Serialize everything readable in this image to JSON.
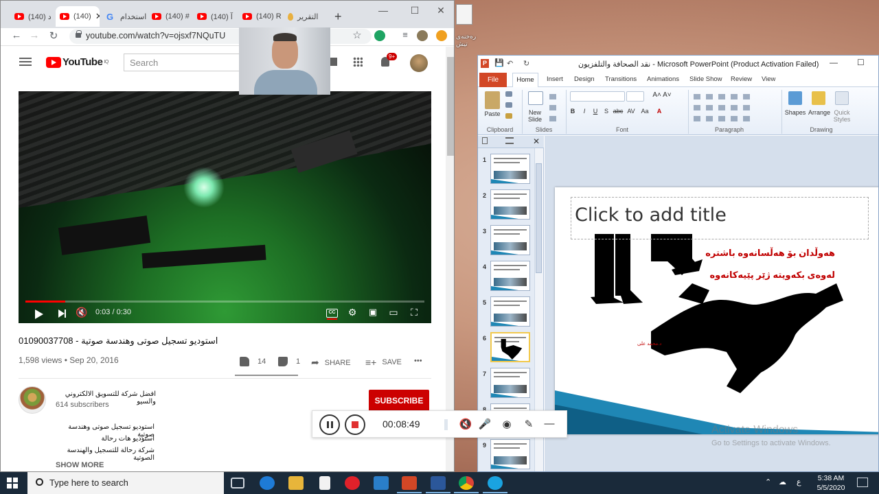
{
  "desktop": {
    "icon_label": "رەخنەی تیش"
  },
  "chrome": {
    "tabs": [
      {
        "label": "(140) د"
      },
      {
        "label": "(140)"
      },
      {
        "label": "استخدام"
      },
      {
        "label": "(140) #"
      },
      {
        "label": "(140) آ"
      },
      {
        "label": "(140) R"
      },
      {
        "label": "التقرير"
      }
    ],
    "new_tab": "+",
    "url": "youtube.com/watch?v=ojsxf7NQuTU"
  },
  "youtube": {
    "logo": "YouTube",
    "logo_region": "IQ",
    "search_placeholder": "Search",
    "notifications": "9+",
    "player": {
      "time": "0:03 / 0:30",
      "cc": "CC",
      "progress": 0.1
    },
    "title": "استوديو تسجيل صوتى وهندسة صوتية - 01090037708",
    "views": "1,598 views • Sep 20, 2016",
    "likes": "14",
    "dislikes": "1",
    "share": "SHARE",
    "save": "SAVE",
    "more": "•••",
    "channel_name": "افضل شركة للتسويق الالكتروني والسيو",
    "subscribers": "614 subscribers",
    "subscribe": "SUBSCRIBE",
    "description": [
      "استوديو تسجيل صوتى وهندسة صوتية",
      "استوديو هات رحالة",
      "شركة رحالة للتسجيل والهندسة الصوتية"
    ],
    "show_more": "SHOW MORE"
  },
  "recorder": {
    "elapsed": "00:08:49"
  },
  "powerpoint": {
    "title": "نقد الصحافة والتلفزيون - Microsoft PowerPoint (Product Activation Failed)",
    "tabs": [
      "File",
      "Home",
      "Insert",
      "Design",
      "Transitions",
      "Animations",
      "Slide Show",
      "Review",
      "View"
    ],
    "groups": [
      "Clipboard",
      "Slides",
      "Font",
      "Paragraph",
      "Drawing"
    ],
    "buttons": {
      "paste": "Paste",
      "new_slide": "New Slide",
      "shapes": "Shapes",
      "arrange": "Arrange",
      "quick_styles": "Quick Styles"
    },
    "font_buttons": [
      "B",
      "I",
      "U",
      "S",
      "abc",
      "AV",
      "Aa",
      "A"
    ],
    "slide_numbers": [
      "1",
      "2",
      "3",
      "4",
      "5",
      "6",
      "7",
      "8",
      "9"
    ],
    "selected_slide": "6",
    "slide": {
      "title_placeholder": "Click to add title",
      "line1": "هەوڵدان بۆ هەڵسانەوە باشترە",
      "line2": "لەوەی بکەویتە ژێر پێیەکانەوە",
      "signature": "د.محمد علی"
    },
    "watermark": "Activate Windows",
    "watermark_sub": "Go to Settings to activate Windows."
  },
  "taskbar": {
    "search_placeholder": "Type here to search",
    "time": "5:38 AM",
    "date": "5/5/2020",
    "lang": "ع"
  },
  "colors": {
    "youtube_red": "#ff0000",
    "subscribe_red": "#cc0000",
    "ppt_orange": "#d24726",
    "slide_red_text": "#c00000",
    "slide_blue": "#1f87b5"
  }
}
